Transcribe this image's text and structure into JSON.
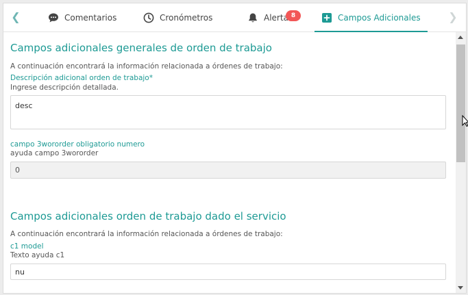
{
  "tabs": [
    {
      "label": "Comentarios",
      "icon": "comment-icon"
    },
    {
      "label": "Cronómetros",
      "icon": "clock-icon"
    },
    {
      "label": "Alertas",
      "icon": "bell-icon",
      "badge": "8"
    },
    {
      "label": "Campos Adicionales",
      "icon": "plus-square-icon",
      "active": true
    }
  ],
  "section1": {
    "title": "Campos adicionales generales de orden de trabajo",
    "description": "A continuación encontrará la información relacionada a órdenes de trabajo:",
    "field1": {
      "label": "Descripción adicional orden de trabajo*",
      "help": "Ingrese descripción detallada.",
      "value": "desc"
    },
    "field2": {
      "label": "campo 3wororder obligatorio numero",
      "help": "ayuda campo 3wororder",
      "value": "0"
    }
  },
  "section2": {
    "title": "Campos adicionales orden de trabajo dado el servicio",
    "description": "A continuación encontrará la información relacionada a órdenes de trabajo:",
    "field1": {
      "label": "c1 model",
      "help": "Texto ayuda c1",
      "value": "nu"
    }
  },
  "colors": {
    "accent": "#1d9a94",
    "badge": "#f25757"
  }
}
